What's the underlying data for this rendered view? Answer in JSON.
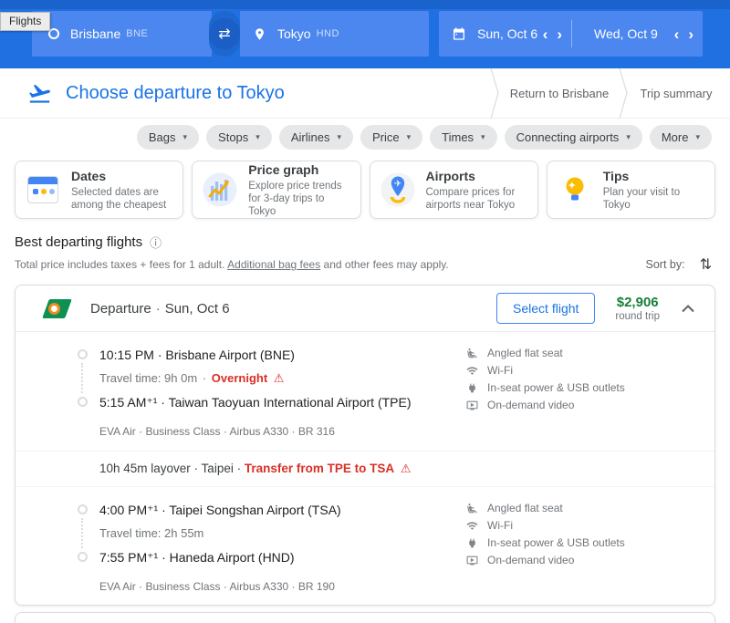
{
  "colors": {
    "accent_blue": "#1a73e8",
    "topbar_blue": "#2170e2",
    "price_green": "#188038",
    "warning_red": "#d93025"
  },
  "icons": {
    "swap": "⇄",
    "chevron_left": "‹",
    "chevron_right": "›",
    "dropdown": "▾",
    "info": "ⓘ",
    "sort": "⇅",
    "warning": "⚠"
  },
  "topbar": {
    "flights_tab": "Flights",
    "origin": {
      "city": "Brisbane",
      "code": "BNE"
    },
    "destination": {
      "city": "Tokyo",
      "code": "HND"
    },
    "dates": {
      "depart": "Sun, Oct 6",
      "return": "Wed, Oct 9"
    }
  },
  "header": {
    "title": "Choose departure to Tokyo",
    "steps": [
      {
        "label": "Return to Brisbane"
      },
      {
        "label": "Trip summary"
      }
    ]
  },
  "filters": [
    {
      "label": "Bags"
    },
    {
      "label": "Stops"
    },
    {
      "label": "Airlines"
    },
    {
      "label": "Price"
    },
    {
      "label": "Times"
    },
    {
      "label": "Connecting airports"
    },
    {
      "label": "More"
    }
  ],
  "feature_cards": [
    {
      "title": "Dates",
      "desc": "Selected dates are among the cheapest"
    },
    {
      "title": "Price graph",
      "desc": "Explore price trends for 3-day trips to Tokyo"
    },
    {
      "title": "Airports",
      "desc": "Compare prices for airports near Tokyo"
    },
    {
      "title": "Tips",
      "desc": "Plan your visit to Tokyo"
    }
  ],
  "results": {
    "heading": "Best departing flights",
    "fees_note_prefix": "Total price includes taxes + fees for 1 adult. ",
    "fees_note_link": "Additional bag fees",
    "fees_note_suffix": " and other fees may apply.",
    "sort_label": "Sort by:"
  },
  "flight_card": {
    "airline": "EVA Air",
    "header_label": "Departure",
    "header_separator": "·",
    "header_date": "Sun, Oct 6",
    "select_button": "Select flight",
    "price": "$2,906",
    "price_note": "round trip",
    "segments": [
      {
        "depart_line": "10:15 PM · Brisbane Airport (BNE)",
        "travel_time": "Travel time: 9h 0m",
        "travel_separator": "·",
        "travel_warning": "Overnight",
        "arrive_line": "5:15 AM⁺¹ · Taiwan Taoyuan International Airport (TPE)",
        "flight_details": "EVA Air · Business Class · Airbus A330 · BR 316",
        "amenities": [
          {
            "label": "Angled flat seat"
          },
          {
            "label": "Wi-Fi"
          },
          {
            "label": "In-seat power & USB outlets"
          },
          {
            "label": "On-demand video"
          }
        ]
      },
      {
        "depart_line": "4:00 PM⁺¹ · Taipei Songshan Airport (TSA)",
        "travel_time": "Travel time: 2h 55m",
        "arrive_line": "7:55 PM⁺¹ · Haneda Airport (HND)",
        "flight_details": "EVA Air · Business Class · Airbus A330 · BR 190",
        "amenities": [
          {
            "label": "Angled flat seat"
          },
          {
            "label": "Wi-Fi"
          },
          {
            "label": "In-seat power & USB outlets"
          },
          {
            "label": "On-demand video"
          }
        ]
      }
    ],
    "layover": {
      "text": "10h 45m layover · Taipei ·",
      "warning": "Transfer from TPE to TSA"
    }
  }
}
